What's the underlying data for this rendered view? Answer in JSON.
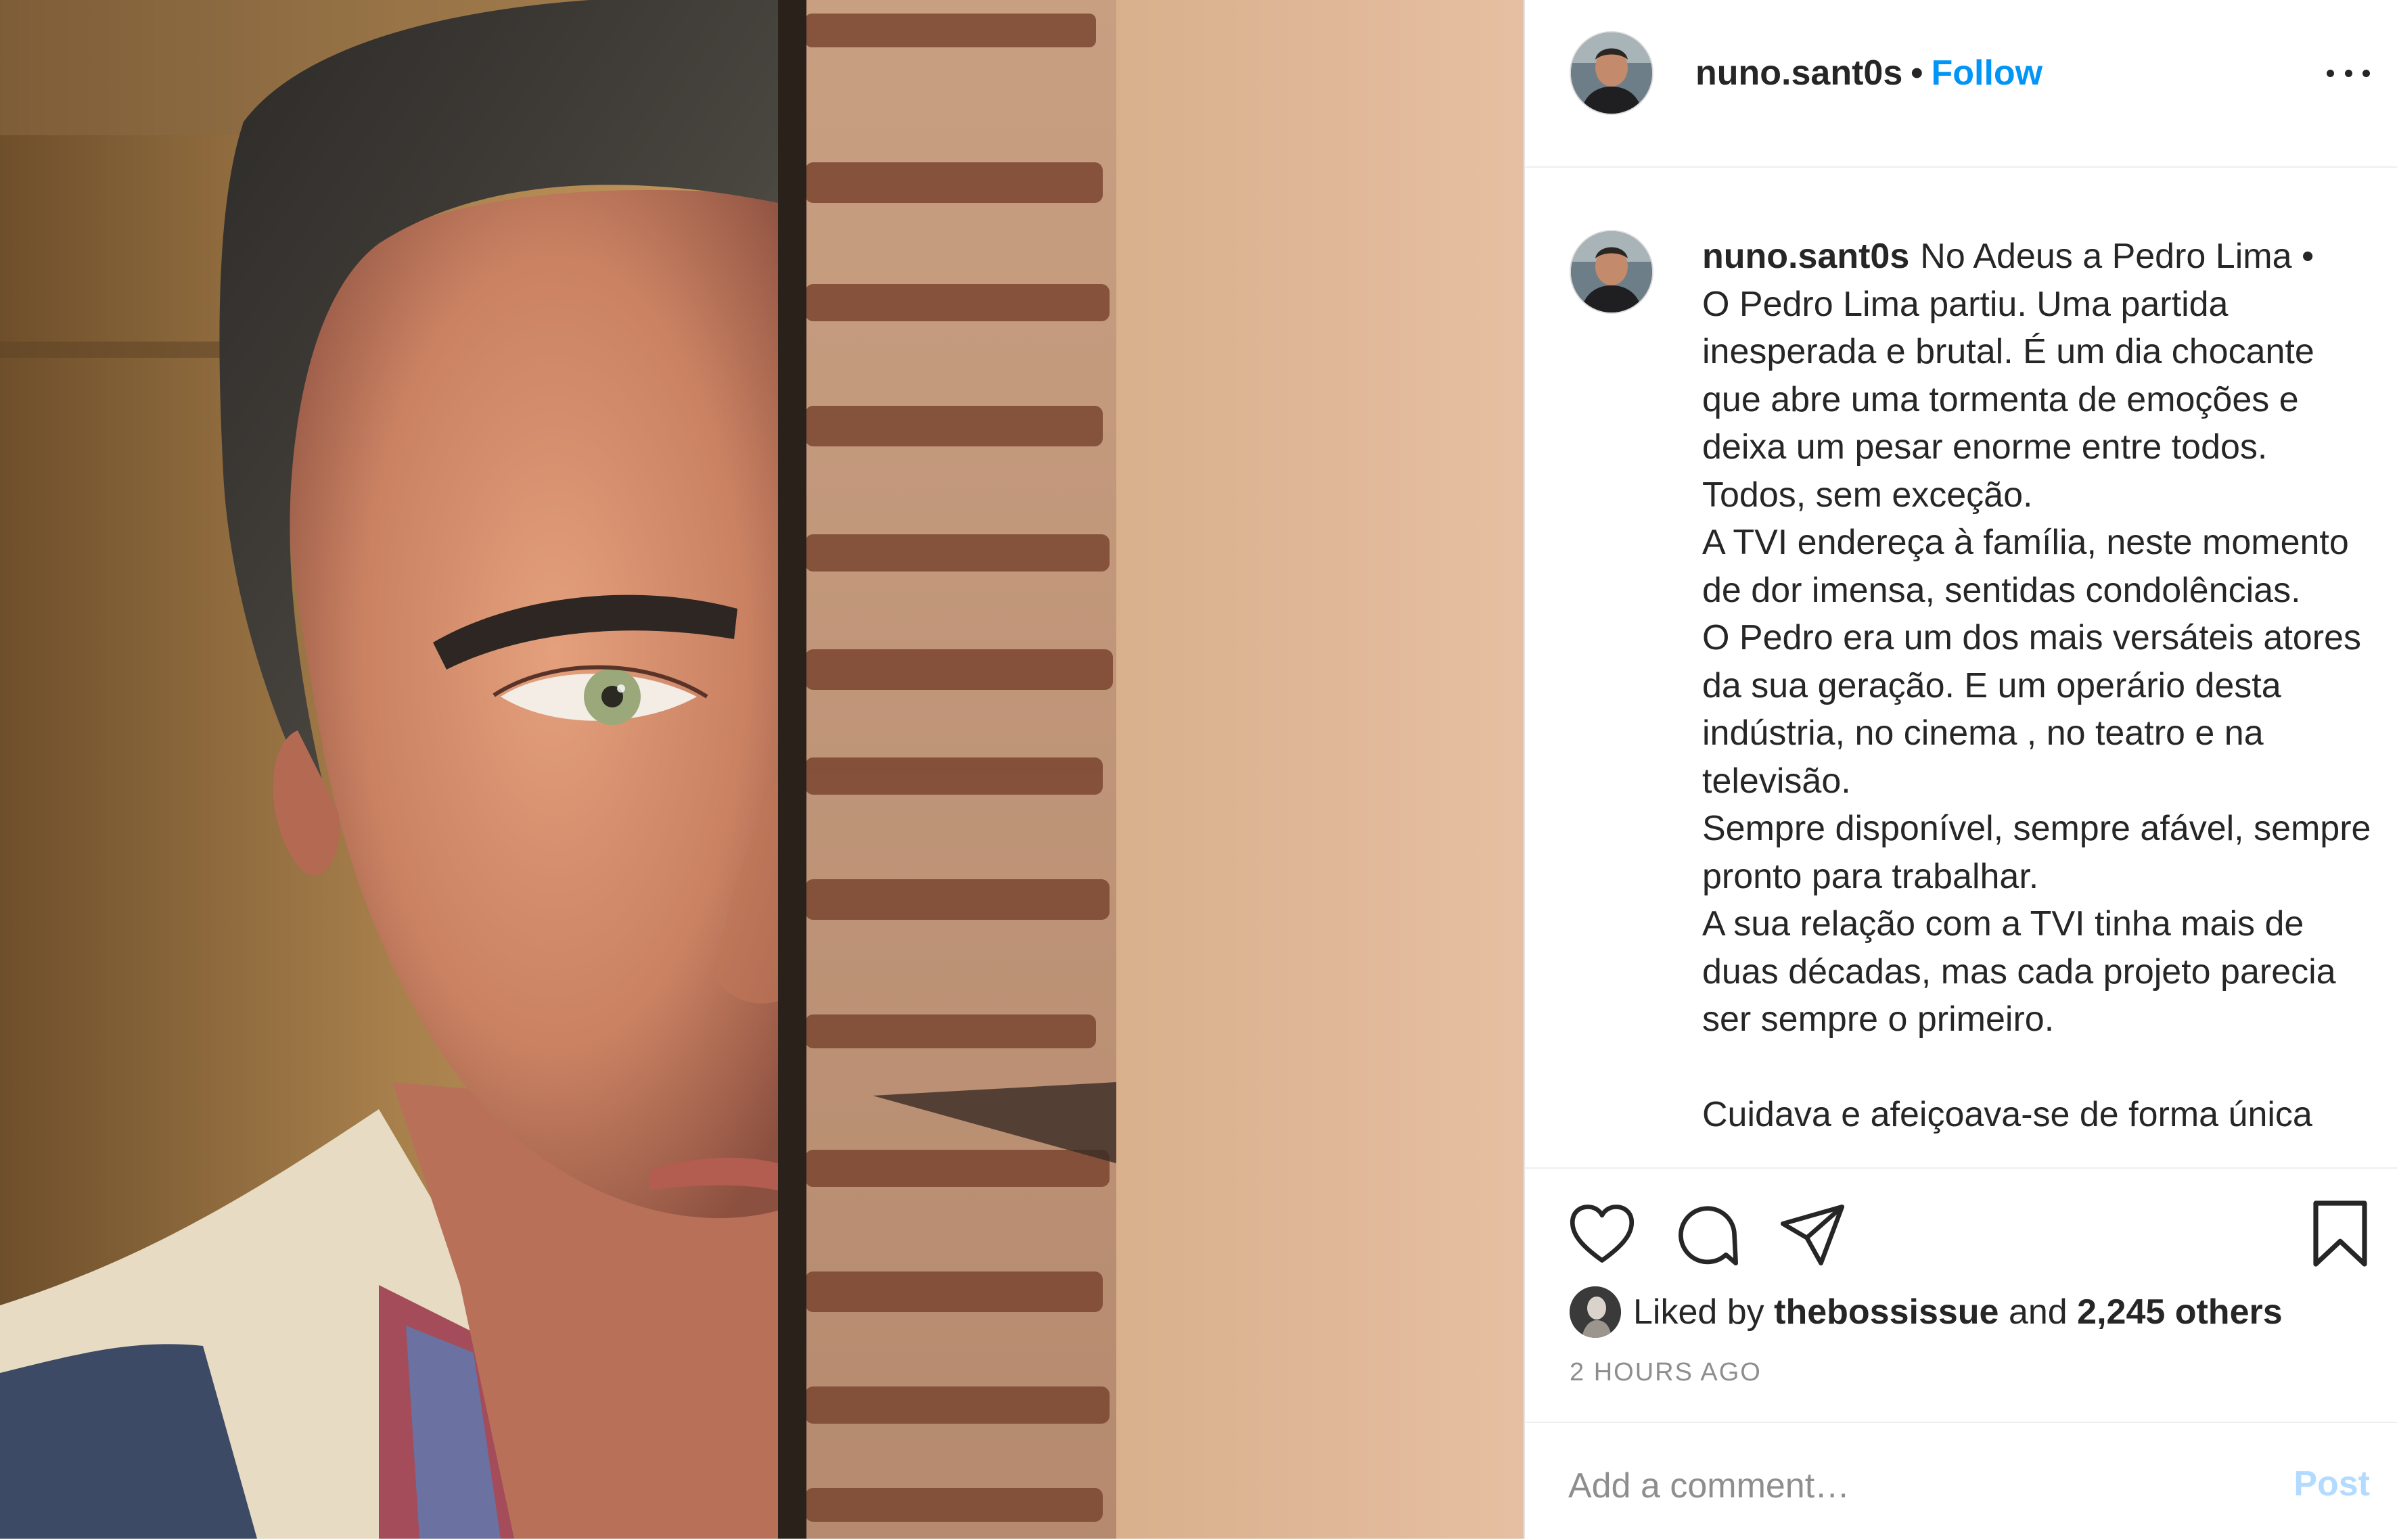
{
  "post": {
    "username": "nuno.sant0s",
    "separator": "•",
    "follow_label": "Follow",
    "more_icon": "more-options-icon"
  },
  "caption": {
    "username": "nuno.sant0s",
    "lines": [
      "No Adeus a Pedro Lima •",
      "O Pedro Lima partiu. Uma partida inesperada e brutal. É um dia chocante que abre uma tormenta de emoções e deixa um pesar enorme entre todos. Todos, sem exceção.",
      "A TVI endereça à família, neste momento de dor imensa, sentidas condolências.",
      "O Pedro era um dos mais versáteis atores da sua geração. E um operário desta indústria, no cinema , no teatro e na televisão.",
      "Sempre disponível, sempre afável, sempre pronto para trabalhar.",
      "A sua relação com a TVI tinha mais de duas décadas, mas cada projeto parecia ser sempre o primeiro."
    ],
    "cutoff_line": "Cuidava e afeiçoava-se de forma única"
  },
  "actions": {
    "icons": [
      "heart-icon",
      "comment-icon",
      "share-icon",
      "bookmark-icon"
    ]
  },
  "likes": {
    "prefix": "Liked by",
    "user": "thebossissue",
    "conjunction": "and",
    "others": "2,245 others"
  },
  "timestamp": "2 HOURS AGO",
  "comment": {
    "placeholder": "Add a comment…",
    "post_label": "Post"
  },
  "colors": {
    "accent": "#0095f6",
    "post_disabled": "#b3dbff",
    "text": "#262626",
    "muted": "#8e8e8e"
  }
}
